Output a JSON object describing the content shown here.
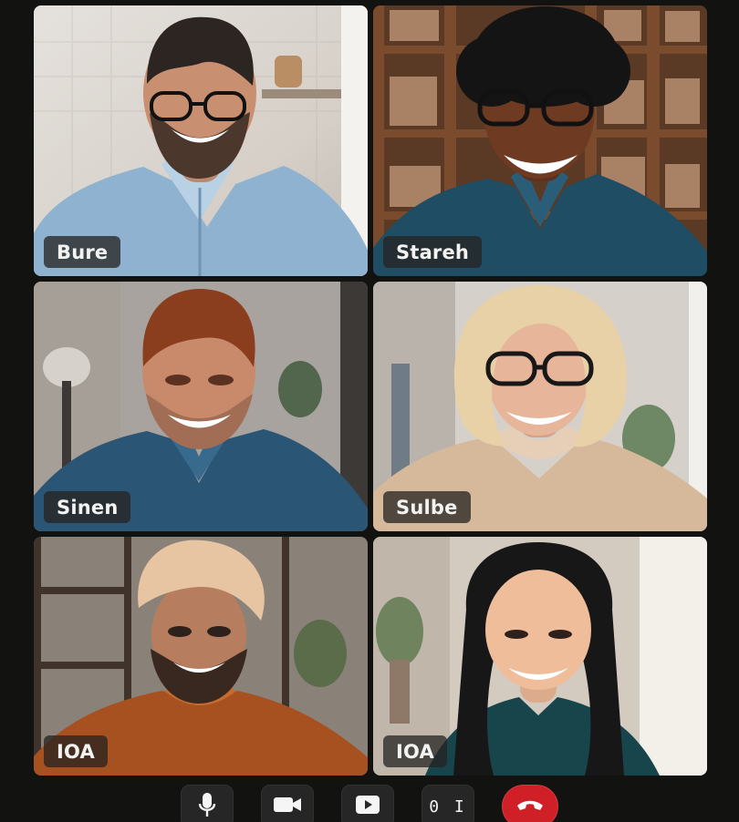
{
  "participants": [
    {
      "name": "Bure"
    },
    {
      "name": "Stareh"
    },
    {
      "name": "Sinen"
    },
    {
      "name": "Sulbe"
    },
    {
      "name": "IOA"
    },
    {
      "name": "IOA"
    }
  ],
  "controls": {
    "microphone_icon": "microphone-icon",
    "camera_icon": "video-camera-icon",
    "share_icon": "play-share-icon",
    "stats_label": "0 I",
    "end_call_icon": "phone-hangup-icon"
  },
  "colors": {
    "background": "#121311",
    "badge": "#262421",
    "end_call": "#cf2028"
  }
}
